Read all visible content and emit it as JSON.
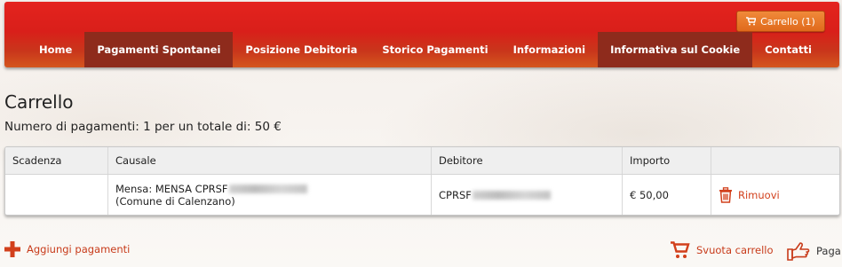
{
  "header": {
    "cart_label": "Carrello (1)",
    "nav": [
      {
        "label": "Home",
        "active": false
      },
      {
        "label": "Pagamenti Spontanei",
        "active": true
      },
      {
        "label": "Posizione Debitoria",
        "active": false
      },
      {
        "label": "Storico Pagamenti",
        "active": false
      },
      {
        "label": "Informazioni",
        "active": false
      },
      {
        "label": "Informativa sul Cookie",
        "active": true
      },
      {
        "label": "Contatti",
        "active": false
      }
    ]
  },
  "page": {
    "title": "Carrello",
    "summary": "Numero di pagamenti: 1  per un totale di: 50 €"
  },
  "table": {
    "headers": [
      "Scadenza",
      "Causale",
      "Debitore",
      "Importo",
      ""
    ],
    "rows": [
      {
        "scadenza": "",
        "causale_line1": "Mensa:  MENSA CPRSF",
        "causale_line2": "(Comune di Calenzano)",
        "debitore": "CPRSF",
        "importo": "€ 50,00",
        "remove_label": "Rimuovi"
      }
    ]
  },
  "actions": {
    "add_label": "Aggiungi pagamenti",
    "empty_label": "Svuota carrello",
    "pay_label": "Paga"
  },
  "colors": {
    "header_red": "#e4231e",
    "active_nav": "#8e2b1c",
    "cart_orange": "#e06a1c",
    "accent_red": "#d2401c"
  }
}
